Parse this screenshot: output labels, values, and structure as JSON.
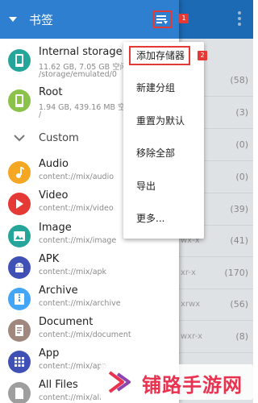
{
  "header": {
    "title": "书签",
    "badge": "1"
  },
  "drawer": {
    "storage": [
      {
        "title": "Internal storage",
        "sub": "11.62 GB, 7.05 GB 空闲",
        "sub2": "/storage/emulated/0",
        "color": "#26a69a"
      },
      {
        "title": "Root",
        "sub": "1.94 GB, 439.16 MB 空闲",
        "sub2": "/",
        "color": "#8bc34a"
      }
    ],
    "section_label": "Custom",
    "items": [
      {
        "title": "Audio",
        "sub": "content://mix/audio",
        "color": "#f5a623",
        "icon": "music-note"
      },
      {
        "title": "Video",
        "sub": "content://mix/video",
        "color": "#e53935",
        "icon": "play"
      },
      {
        "title": "Image",
        "sub": "content://mix/image",
        "color": "#26a69a",
        "icon": "image"
      },
      {
        "title": "APK",
        "sub": "content://mix/apk",
        "color": "#3f51b5",
        "icon": "android"
      },
      {
        "title": "Archive",
        "sub": "content://mix/archive",
        "color": "#42a5f5",
        "icon": "archive"
      },
      {
        "title": "Document",
        "sub": "content://mix/document",
        "color": "#a1887f",
        "icon": "document"
      },
      {
        "title": "App",
        "sub": "content://mix/app",
        "color": "#3f51b5",
        "icon": "grid"
      },
      {
        "title": "All Files",
        "sub": "content://mix/all",
        "color": "#9e9e9e",
        "icon": "file"
      }
    ]
  },
  "menu": {
    "items": [
      "添加存储器",
      "新建分组",
      "重置为默认",
      "移除全部",
      "导出",
      "更多..."
    ],
    "badge": "2"
  },
  "background": {
    "counts": [
      "(58)",
      "(3)",
      "(0)",
      "(0)",
      "(39)",
      "(41)",
      "(170)",
      "(56)",
      "(8)"
    ],
    "perms": [
      "",
      "",
      "",
      "",
      "",
      "wx-x",
      "xr-x",
      "xrwx",
      "wxr-x"
    ]
  },
  "watermark": {
    "text": "铺路手游网"
  }
}
